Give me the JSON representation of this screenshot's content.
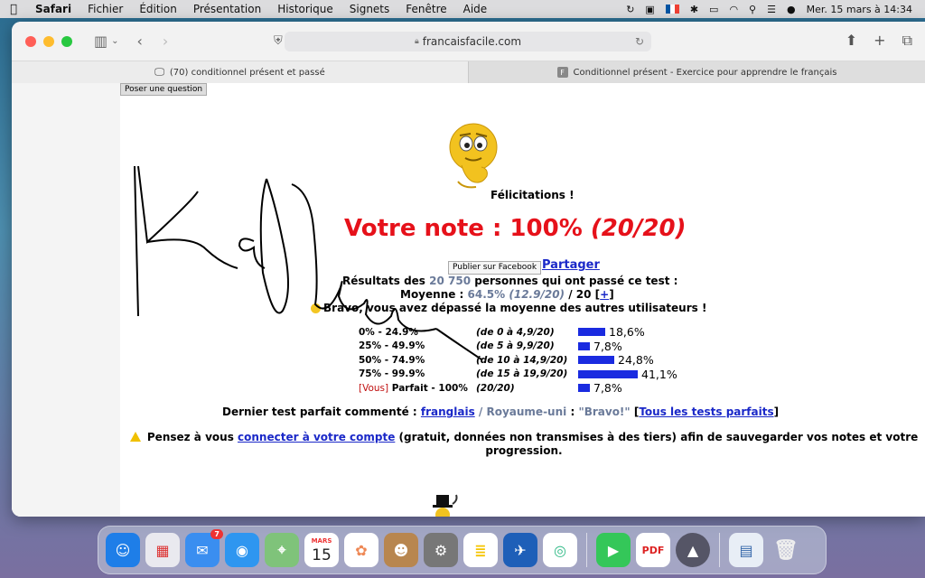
{
  "menubar": {
    "app": "Safari",
    "menus": [
      "Fichier",
      "Édition",
      "Présentation",
      "Historique",
      "Signets",
      "Fenêtre",
      "Aide"
    ],
    "datetime": "Mer. 15 mars à  14:34"
  },
  "toolbar": {
    "url": "francaisfacile.com"
  },
  "tabs": [
    {
      "label": "(70) conditionnel présent et passé"
    },
    {
      "label": "Conditionnel présent - Exercice pour apprendre le français"
    }
  ],
  "page": {
    "ask_button": "Poser une question",
    "felicitations": "Félicitations !",
    "note_label": "Votre note : 100%",
    "note_score": "(20/20)",
    "facebook_button": "Publier sur Facebook",
    "share_link": "Partager",
    "results_prefix": "Résultats des",
    "results_count": "20 750",
    "results_suffix": "personnes qui ont passé ce test :",
    "moyenne_label": "Moyenne :",
    "moyenne_pct": "64.5%",
    "moyenne_score": "(12.9/20)",
    "moyenne_total": "/ 20",
    "moyenne_more": "+",
    "bravo": "Bravo, vous avez dépassé la moyenne des autres utilisateurs !",
    "distribution": [
      {
        "range": "0% - 24.9%",
        "score": "(de 0 à 4,9/20)",
        "value": 18.6,
        "pct": "18,6%"
      },
      {
        "range": "25% - 49.9%",
        "score": "(de 5 à 9,9/20)",
        "value": 7.8,
        "pct": "7,8%"
      },
      {
        "range": "50% - 74.9%",
        "score": "(de 10 à 14,9/20)",
        "value": 24.8,
        "pct": "24,8%"
      },
      {
        "range": "75% - 99.9%",
        "score": "(de 15 à 19,9/20)",
        "value": 41.1,
        "pct": "41,1%"
      },
      {
        "vous": "[Vous]",
        "range": "Parfait - 100%",
        "score": "(20/20)",
        "value": 7.8,
        "pct": "7,8%"
      }
    ],
    "dernier_label": "Dernier test parfait commenté :",
    "dernier_user": "franglais",
    "dernier_country": "/ Royaume-uni",
    "dernier_sep": ":",
    "dernier_comment": "\"Bravo!\"",
    "dernier_all": "Tous les tests parfaits",
    "pensez_prefix": "Pensez à vous",
    "pensez_link": "connecter à votre compte",
    "pensez_suffix": "(gratuit, données non transmises à des tiers) afin de sauvegarder vos notes et votre progression."
  },
  "dock": {
    "mail_badge": "7",
    "calendar_month": "MARS",
    "calendar_day": "15"
  },
  "colors": {
    "note_red": "#e6111a",
    "link_blue": "#1a28c8",
    "bar_blue": "#1a2be0",
    "muted_gray": "#6a7a99"
  }
}
